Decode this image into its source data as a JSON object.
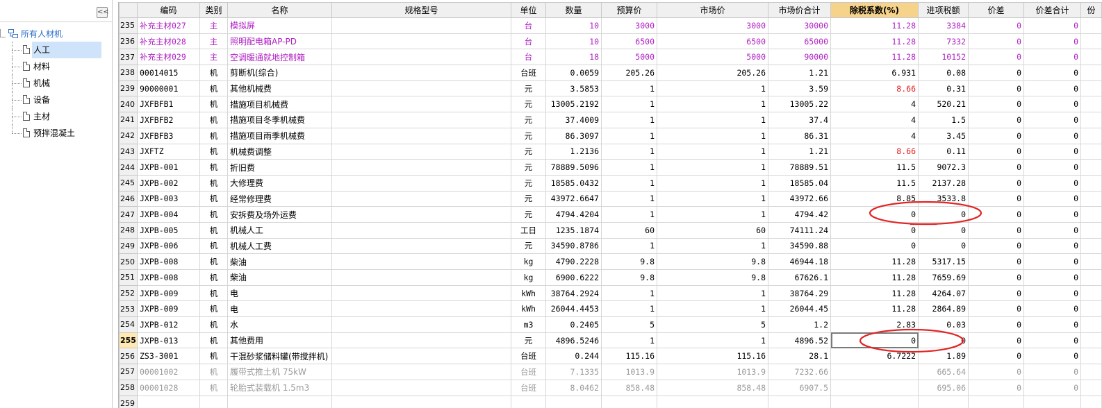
{
  "tree": {
    "collapse_glyph": "<<",
    "root": "所有人材机",
    "items": [
      "人工",
      "材料",
      "机械",
      "设备",
      "主材",
      "预拌混凝土"
    ]
  },
  "headers": [
    "编码",
    "类别",
    "名称",
    "规格型号",
    "单位",
    "数量",
    "预算价",
    "市场价",
    "市场价合计",
    "除税系数(%)",
    "进项税额",
    "价差",
    "价差合计",
    "份"
  ],
  "rows": [
    {
      "n": "235",
      "code": "补充主材027",
      "type": "主",
      "name": "模拟屏",
      "spec": "",
      "unit": "台",
      "qty": "10",
      "budget": "3000",
      "market": "3000",
      "total": "30000",
      "coef": "11.28",
      "tax": "3384",
      "diff": "0",
      "dsum": "0",
      "extra": "",
      "style": "purple"
    },
    {
      "n": "236",
      "code": "补充主材028",
      "type": "主",
      "name": "照明配电箱AP-PD",
      "spec": "",
      "unit": "台",
      "qty": "10",
      "budget": "6500",
      "market": "6500",
      "total": "65000",
      "coef": "11.28",
      "tax": "7332",
      "diff": "0",
      "dsum": "0",
      "extra": "",
      "style": "purple"
    },
    {
      "n": "237",
      "code": "补充主材029",
      "type": "主",
      "name": "空调暖通就地控制箱",
      "spec": "",
      "unit": "台",
      "qty": "18",
      "budget": "5000",
      "market": "5000",
      "total": "90000",
      "coef": "11.28",
      "tax": "10152",
      "diff": "0",
      "dsum": "0",
      "extra": "",
      "style": "purple"
    },
    {
      "n": "238",
      "code": "00014015",
      "type": "机",
      "name": "剪断机(综合)",
      "spec": "",
      "unit": "台班",
      "qty": "0.0059",
      "budget": "205.26",
      "market": "205.26",
      "total": "1.21",
      "coef": "6.931",
      "tax": "0.08",
      "diff": "0",
      "dsum": "0",
      "extra": "",
      "style": ""
    },
    {
      "n": "239",
      "code": "90000001",
      "type": "机",
      "name": "其他机械费",
      "spec": "",
      "unit": "元",
      "qty": "3.5853",
      "budget": "1",
      "market": "1",
      "total": "3.59",
      "coef": "8.66",
      "tax": "0.31",
      "diff": "0",
      "dsum": "0",
      "extra": "",
      "style": "",
      "coef_red": true
    },
    {
      "n": "240",
      "code": "JXFBFB1",
      "type": "机",
      "name": "措施项目机械费",
      "spec": "",
      "unit": "元",
      "qty": "13005.2192",
      "budget": "1",
      "market": "1",
      "total": "13005.22",
      "coef": "4",
      "tax": "520.21",
      "diff": "0",
      "dsum": "0",
      "extra": "",
      "style": ""
    },
    {
      "n": "241",
      "code": "JXFBFB2",
      "type": "机",
      "name": "措施项目冬季机械费",
      "spec": "",
      "unit": "元",
      "qty": "37.4009",
      "budget": "1",
      "market": "1",
      "total": "37.4",
      "coef": "4",
      "tax": "1.5",
      "diff": "0",
      "dsum": "0",
      "extra": "",
      "style": ""
    },
    {
      "n": "242",
      "code": "JXFBFB3",
      "type": "机",
      "name": "措施项目雨季机械费",
      "spec": "",
      "unit": "元",
      "qty": "86.3097",
      "budget": "1",
      "market": "1",
      "total": "86.31",
      "coef": "4",
      "tax": "3.45",
      "diff": "0",
      "dsum": "0",
      "extra": "",
      "style": ""
    },
    {
      "n": "243",
      "code": "JXFTZ",
      "type": "机",
      "name": "机械费调整",
      "spec": "",
      "unit": "元",
      "qty": "1.2136",
      "budget": "1",
      "market": "1",
      "total": "1.21",
      "coef": "8.66",
      "tax": "0.11",
      "diff": "0",
      "dsum": "0",
      "extra": "",
      "style": "",
      "coef_red": true
    },
    {
      "n": "244",
      "code": "JXPB-001",
      "type": "机",
      "name": "折旧费",
      "spec": "",
      "unit": "元",
      "qty": "78889.5096",
      "budget": "1",
      "market": "1",
      "total": "78889.51",
      "coef": "11.5",
      "tax": "9072.3",
      "diff": "0",
      "dsum": "0",
      "extra": "",
      "style": ""
    },
    {
      "n": "245",
      "code": "JXPB-002",
      "type": "机",
      "name": "大修理费",
      "spec": "",
      "unit": "元",
      "qty": "18585.0432",
      "budget": "1",
      "market": "1",
      "total": "18585.04",
      "coef": "11.5",
      "tax": "2137.28",
      "diff": "0",
      "dsum": "0",
      "extra": "",
      "style": ""
    },
    {
      "n": "246",
      "code": "JXPB-003",
      "type": "机",
      "name": "经常修理费",
      "spec": "",
      "unit": "元",
      "qty": "43972.6647",
      "budget": "1",
      "market": "1",
      "total": "43972.66",
      "coef": "8.85",
      "tax": "3533.8",
      "diff": "0",
      "dsum": "0",
      "extra": "",
      "style": ""
    },
    {
      "n": "247",
      "code": "JXPB-004",
      "type": "机",
      "name": "安拆费及场外运费",
      "spec": "",
      "unit": "元",
      "qty": "4794.4204",
      "budget": "1",
      "market": "1",
      "total": "4794.42",
      "coef": "0",
      "tax": "0",
      "diff": "0",
      "dsum": "0",
      "extra": "",
      "style": ""
    },
    {
      "n": "248",
      "code": "JXPB-005",
      "type": "机",
      "name": "机械人工",
      "spec": "",
      "unit": "工日",
      "qty": "1235.1874",
      "budget": "60",
      "market": "60",
      "total": "74111.24",
      "coef": "0",
      "tax": "0",
      "diff": "0",
      "dsum": "0",
      "extra": "",
      "style": ""
    },
    {
      "n": "249",
      "code": "JXPB-006",
      "type": "机",
      "name": "机械人工费",
      "spec": "",
      "unit": "元",
      "qty": "34590.8786",
      "budget": "1",
      "market": "1",
      "total": "34590.88",
      "coef": "0",
      "tax": "0",
      "diff": "0",
      "dsum": "0",
      "extra": "",
      "style": ""
    },
    {
      "n": "250",
      "code": "JXPB-008",
      "type": "机",
      "name": "柴油",
      "spec": "",
      "unit": "kg",
      "qty": "4790.2228",
      "budget": "9.8",
      "market": "9.8",
      "total": "46944.18",
      "coef": "11.28",
      "tax": "5317.15",
      "diff": "0",
      "dsum": "0",
      "extra": "",
      "style": ""
    },
    {
      "n": "251",
      "code": "JXPB-008",
      "type": "机",
      "name": "柴油",
      "spec": "",
      "unit": "kg",
      "qty": "6900.6222",
      "budget": "9.8",
      "market": "9.8",
      "total": "67626.1",
      "coef": "11.28",
      "tax": "7659.69",
      "diff": "0",
      "dsum": "0",
      "extra": "",
      "style": ""
    },
    {
      "n": "252",
      "code": "JXPB-009",
      "type": "机",
      "name": "电",
      "spec": "",
      "unit": "kWh",
      "qty": "38764.2924",
      "budget": "1",
      "market": "1",
      "total": "38764.29",
      "coef": "11.28",
      "tax": "4264.07",
      "diff": "0",
      "dsum": "0",
      "extra": "",
      "style": ""
    },
    {
      "n": "253",
      "code": "JXPB-009",
      "type": "机",
      "name": "电",
      "spec": "",
      "unit": "kWh",
      "qty": "26044.4453",
      "budget": "1",
      "market": "1",
      "total": "26044.45",
      "coef": "11.28",
      "tax": "2864.89",
      "diff": "0",
      "dsum": "0",
      "extra": "",
      "style": ""
    },
    {
      "n": "254",
      "code": "JXPB-012",
      "type": "机",
      "name": "水",
      "spec": "",
      "unit": "m3",
      "qty": "0.2405",
      "budget": "5",
      "market": "5",
      "total": "1.2",
      "coef": "2.83",
      "tax": "0.03",
      "diff": "0",
      "dsum": "0",
      "extra": "",
      "style": ""
    },
    {
      "n": "255",
      "code": "JXPB-013",
      "type": "机",
      "name": "其他费用",
      "spec": "",
      "unit": "元",
      "qty": "4896.5246",
      "budget": "1",
      "market": "1",
      "total": "4896.52",
      "coef": "0",
      "tax": "0",
      "diff": "0",
      "dsum": "0",
      "extra": "",
      "style": "",
      "current": true
    },
    {
      "n": "256",
      "code": "ZS3-3001",
      "type": "机",
      "name": "干混砂浆储料罐(带搅拌机)",
      "spec": "",
      "unit": "台班",
      "qty": "0.244",
      "budget": "115.16",
      "market": "115.16",
      "total": "28.1",
      "coef": "6.7222",
      "tax": "1.89",
      "diff": "0",
      "dsum": "0",
      "extra": "",
      "style": ""
    },
    {
      "n": "257",
      "code": "00001002",
      "type": "机",
      "name": "履带式推土机 75kW",
      "spec": "",
      "unit": "台班",
      "qty": "7.1335",
      "budget": "1013.9",
      "market": "1013.9",
      "total": "7232.66",
      "coef": "",
      "tax": "665.64",
      "diff": "0",
      "dsum": "0",
      "extra": "",
      "style": "gray"
    },
    {
      "n": "258",
      "code": "00001028",
      "type": "机",
      "name": "轮胎式装载机 1.5m3",
      "spec": "",
      "unit": "台班",
      "qty": "8.0462",
      "budget": "858.48",
      "market": "858.48",
      "total": "6907.5",
      "coef": "",
      "tax": "695.06",
      "diff": "0",
      "dsum": "0",
      "extra": "",
      "style": "gray"
    },
    {
      "n": "259",
      "code": "",
      "type": "",
      "name": "",
      "spec": "",
      "unit": "",
      "qty": "",
      "budget": "",
      "market": "",
      "total": "",
      "coef": "",
      "tax": "",
      "diff": "",
      "dsum": "",
      "extra": "",
      "style": ""
    }
  ]
}
